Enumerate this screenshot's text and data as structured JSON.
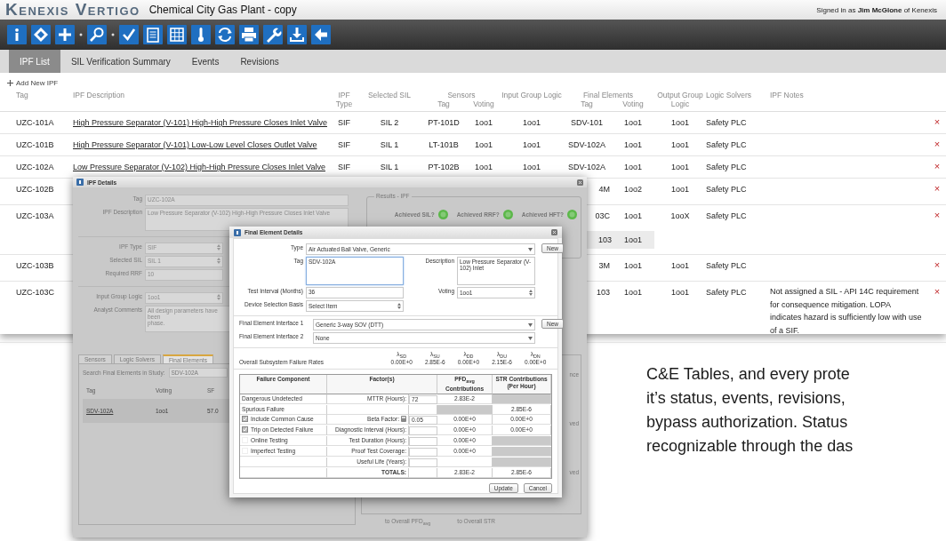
{
  "app": {
    "logo": "Kenexis Vertigo",
    "project": "Chemical City Gas Plant - copy",
    "signed_in": "Signed in as **Jim McGlone** of Kenexis",
    "tabs": [
      {
        "label": "IPF List",
        "selected": true
      },
      {
        "label": "SIL Verification Summary",
        "selected": false
      },
      {
        "label": "Events",
        "selected": false
      },
      {
        "label": "Revisions",
        "selected": false
      }
    ],
    "add_new": "Add New IPF",
    "table": {
      "columns": [
        "Tag",
        "IPF Description",
        "IPF Type",
        "Selected SIL",
        "Tag",
        "Voting",
        "Input Group Logic",
        "Tag",
        "Voting",
        "Output Group Logic",
        "Logic Solvers",
        "IPF Notes"
      ],
      "groups": [
        {
          "label": "Sensors"
        },
        {
          "label": "Final Elements"
        }
      ],
      "rows": [
        {
          "tag": "UZC-101A",
          "description": "High Pressure Separator (V-101) High-High Pressure Closes Inlet Valve",
          "ipf_type": "SIF",
          "sil": "SIL 2",
          "sensor_tag": "PT-101D",
          "sensor_voting": "1oo1",
          "input_logic": "1oo1",
          "final_tag": "SDV-101",
          "final_voting": "1oo1",
          "output_logic": "1oo1",
          "logic_solver": "Safety PLC",
          "delete": "×"
        },
        {
          "tag": "UZC-101B",
          "description": "High Pressure Separator (V-101) Low-Low Level Closes Outlet Valve",
          "ipf_type": "SIF",
          "sil": "SIL 1",
          "sensor_tag": "LT-101B",
          "sensor_voting": "1oo1",
          "input_logic": "1oo1",
          "final_tag": "SDV-102A",
          "final_voting": "1oo1",
          "output_logic": "1oo1",
          "logic_solver": "Safety PLC",
          "delete": "×"
        },
        {
          "tag": "UZC-102A",
          "description": "Low Pressure Separator (V-102) High-High Pressure Closes Inlet Valve",
          "ipf_type": "SIF",
          "sil": "SIL 1",
          "sensor_tag": "PT-102B",
          "sensor_voting": "1oo1",
          "input_logic": "1oo1",
          "final_tag": "SDV-102A",
          "final_voting": "1oo1",
          "output_logic": "1oo1",
          "logic_solver": "Safety PLC",
          "delete": "×"
        },
        {
          "tag": "UZC-102B",
          "final_tag": "4M",
          "final_voting": "1oo2",
          "output_logic": "1oo1",
          "logic_solver": "Safety PLC",
          "delete": "×"
        },
        {
          "tag": "UZC-103A",
          "final_tag": "03C",
          "final_voting": "1oo1",
          "output_logic": "1ooX",
          "logic_solver": "Safety PLC",
          "delete": "×",
          "sub": {
            "final_tag": "103",
            "final_voting": "1oo1"
          }
        },
        {
          "tag": "UZC-103B",
          "final_tag": "3M",
          "final_voting": "1oo1",
          "output_logic": "1oo1",
          "logic_solver": "Safety PLC",
          "delete": "×"
        },
        {
          "tag": "UZC-103C",
          "final_tag": "103",
          "final_voting": "1oo1",
          "output_logic": "1oo1",
          "logic_solver": "Safety PLC",
          "notes": "Not assigned a SIL - API 14C requirement for consequence mitigation.  LOPA indicates hazard is sufficiently low with use of a SIF.",
          "delete": "×"
        }
      ]
    }
  },
  "ipf_details": {
    "title": "IPF Details",
    "general": [
      {
        "label": "Tag",
        "value": "UZC-102A",
        "kind": "text"
      },
      {
        "label": "IPF Description",
        "value": "Low Pressure Separator (V-102) High-High Pressure Closes Inlet Valve",
        "kind": "area"
      }
    ],
    "settings": [
      {
        "label": "IPF Type",
        "value": "SIF",
        "kind": "select"
      },
      {
        "label": "Selected SIL",
        "value": "SIL 1",
        "kind": "select"
      },
      {
        "label": "Required RRF",
        "value": "10",
        "kind": "text"
      }
    ],
    "logic": [
      {
        "label": "Input Group Logic",
        "value": "1oo1",
        "kind": "select"
      },
      {
        "label": "Analyst Comments",
        "value": "All design parameters have been\nphase.",
        "kind": "area"
      }
    ],
    "results": {
      "title": "Results - IPF",
      "items": [
        {
          "label": "Achieved SIL?",
          "achieved": true
        },
        {
          "label": "Achieved RRF?",
          "achieved": true
        },
        {
          "label": "Achieved HFT?",
          "achieved": true
        }
      ]
    },
    "tabs": [
      {
        "label": "Sensors",
        "selected": false
      },
      {
        "label": "Logic Solvers",
        "selected": false
      },
      {
        "label": "Final Elements",
        "selected": true
      }
    ],
    "search_label": "Search Final Elements in Study:",
    "search_value": "SDV-102A",
    "list_columns": [
      "Tag",
      "Voting",
      "SF"
    ],
    "list_rows": [
      {
        "tag": "SDV-102A",
        "voting": "1oo1",
        "column_3": "57.0"
      }
    ],
    "side_texts": [
      "nce",
      "ved",
      "ved"
    ],
    "side_footer": [
      "to Overall PFD$_{avg}$",
      "to Overall STR"
    ]
  },
  "fe_details": {
    "title": "Final Element Details",
    "type": {
      "label": "Type",
      "value": "Air Actuated Ball Valve, Generic",
      "button": "New"
    },
    "tag": {
      "label": "Tag",
      "value": "SDV-102A"
    },
    "description": {
      "label": "Description",
      "value": "Low Pressure Separator (V-102) Inlet"
    },
    "test_interval": {
      "label": "Test Interval (Months)",
      "value": "36"
    },
    "voting": {
      "label": "Voting",
      "value": "1oo1"
    },
    "selection_basis": {
      "label": "Device Selection Basis",
      "value": "Select Item"
    },
    "interfaces": [
      {
        "label": "Final Element Interface 1",
        "value": "Generic 3-way SOV (DTT)",
        "button": "New"
      },
      {
        "label": "Final Element Interface 2",
        "value": "None"
      }
    ],
    "rates": {
      "label": "Overall Subsystem Failure Rates",
      "items": [
        {
          "symbol": "λ$_{SD}$",
          "value": "0.00E+0"
        },
        {
          "symbol": "λ$_{SU}$",
          "value": "2.85E-6"
        },
        {
          "symbol": "λ$_{DD}$",
          "value": "0.00E+0"
        },
        {
          "symbol": "λ$_{DU}$",
          "value": "2.15E-6"
        },
        {
          "symbol": "λ$_{DN}$",
          "value": "0.00E+0"
        }
      ]
    },
    "table": {
      "columns": [
        "Failure Component",
        "Factor(s)",
        "PFD$_{avg}$ Contributions",
        "STR Contributions (Per Hour)"
      ],
      "rows": [
        {
          "kind": "plain",
          "component": "Dangerous Undetected",
          "factor": "MTTR (Hours):",
          "input": true,
          "calc": false,
          "value": "72",
          "pfd": "2.83E-2",
          "pfd_na": false,
          "str_na": true
        },
        {
          "kind": "plain",
          "component": "Spurious Failure",
          "input": false,
          "calc": false,
          "pfd_na": true,
          "str": "2.85E-6",
          "str_na": false
        },
        {
          "kind": "check",
          "checked": true,
          "component": "Include Common Cause",
          "factor": "Beta Factor:",
          "input": true,
          "calc": true,
          "value": "0.05",
          "pfd": "0.00E+0",
          "pfd_na": false,
          "str": "0.00E+0",
          "str_na": false
        },
        {
          "kind": "check",
          "checked": true,
          "component": "Trip on Detected Failure",
          "factor": "Diagnostic Interval (Hours):",
          "input": true,
          "calc": false,
          "pfd": "0.00E+0",
          "pfd_na": false,
          "str": "0.00E+0",
          "str_na": false
        },
        {
          "kind": "check",
          "checked": false,
          "component": "Online Testing",
          "factor": "Test Duration (Hours):",
          "input": true,
          "calc": false,
          "pfd": "0.00E+0",
          "pfd_na": false,
          "str_na": true
        },
        {
          "kind": "check",
          "checked": false,
          "component": "Imperfect Testing",
          "factor": "Proof Test Coverage:",
          "input": true,
          "calc": false,
          "pfd": "0.00E+0",
          "pfd_na": false,
          "str_na": true
        },
        {
          "kind": "plain",
          "factor": "Useful Life (Years):",
          "input": true,
          "calc": false,
          "pfd_na": false,
          "str_na": true
        },
        {
          "kind": "totals",
          "factor": "TOTALS:",
          "input": false,
          "calc": false,
          "pfd": "2.83E-2",
          "pfd_na": false,
          "str": "2.85E-6",
          "str_na": false
        }
      ]
    },
    "buttons": [
      "Update",
      "Cancel"
    ]
  },
  "slide_text": [
    "C&E Tables, and every prote",
    "it’s status, events, revisions,",
    "bypass authorization. Status",
    "recognizable through the das"
  ]
}
